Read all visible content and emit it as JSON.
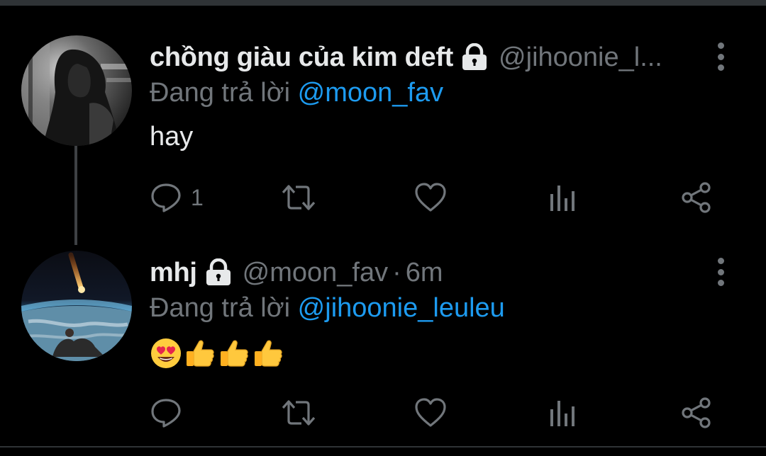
{
  "tweets": [
    {
      "display_name": "chồng giàu của kim deft",
      "handle": "@jihoonie_l...",
      "time": "",
      "replying_prefix": "Đang trả lời",
      "replying_to": "@moon_fav",
      "text": "hay",
      "emojis": [],
      "reply_count": "1",
      "avatar": "avatar-dark-hooded-figure",
      "icons": [
        "lock-icon",
        "more-icon",
        "reply-icon",
        "retweet-icon",
        "like-icon",
        "views-icon",
        "share-icon"
      ]
    },
    {
      "display_name": "mhj",
      "handle": "@moon_fav",
      "separator": "·",
      "time": "6m",
      "replying_prefix": "Đang trả lời",
      "replying_to": "@jihoonie_leuleu",
      "text": "",
      "emojis": [
        "heart-eyes-emoji",
        "thumbs-up-emoji",
        "thumbs-up-emoji",
        "thumbs-up-emoji"
      ],
      "reply_count": "",
      "avatar": "avatar-earth-meteor",
      "icons": [
        "lock-icon",
        "more-icon",
        "reply-icon",
        "retweet-icon",
        "like-icon",
        "views-icon",
        "share-icon"
      ]
    }
  ],
  "colors": {
    "background": "#000000",
    "text_primary": "#e7e9ea",
    "text_secondary": "#71767b",
    "link": "#1d9bf0",
    "thread_line": "#3e4144"
  }
}
